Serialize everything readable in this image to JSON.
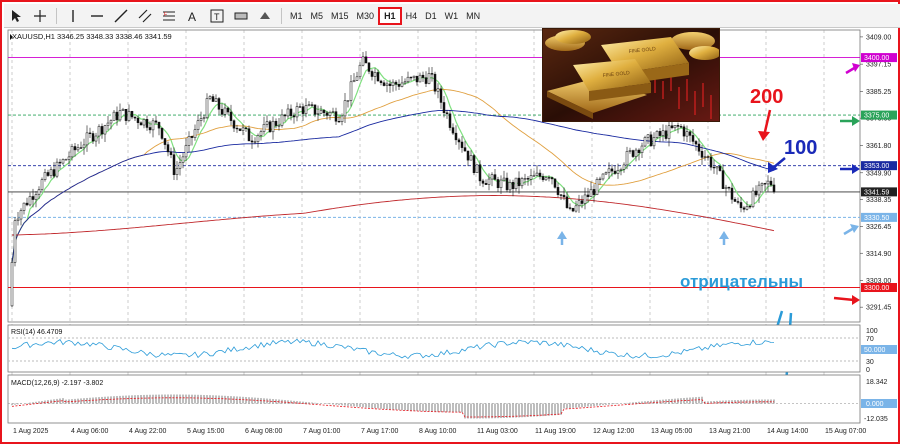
{
  "toolbar": {
    "timeframes": [
      "M1",
      "M5",
      "M15",
      "M30",
      "H1",
      "H4",
      "D1",
      "W1",
      "MN"
    ],
    "active_timeframe": "H1"
  },
  "header": {
    "symbol_info": "XAUUSD,H1  3346.25 3348.33 3338.46 3341.59"
  },
  "price_axis": {
    "ticks": [
      "3409.00",
      "3397.15",
      "3385.25",
      "3373.65",
      "3361.80",
      "3349.90",
      "3338.35",
      "3326.45",
      "3314.90",
      "3303.00",
      "3291.45"
    ],
    "levels": [
      {
        "label": "3400.00",
        "color": "#d000d0",
        "value": 3400.0
      },
      {
        "label": "3375.00",
        "color": "#2aa35a",
        "value": 3375.0
      },
      {
        "label": "3353.00",
        "color": "#1a2aa0",
        "value": 3353.0
      },
      {
        "label": "3341.59",
        "color": "#333333",
        "value": 3341.59
      },
      {
        "label": "3330.50",
        "color": "#7ab4e8",
        "value": 3330.5
      },
      {
        "label": "3300.00",
        "color": "#e8141c",
        "value": 3300.0
      }
    ],
    "range": [
      3285,
      3412
    ]
  },
  "time_axis": {
    "labels": [
      "1 Aug 2025",
      "4 Aug 06:00",
      "4 Aug 22:00",
      "5 Aug 15:00",
      "6 Aug 08:00",
      "7 Aug 01:00",
      "7 Aug 17:00",
      "8 Aug 10:00",
      "11 Aug 03:00",
      "11 Aug 19:00",
      "12 Aug 12:00",
      "13 Aug 05:00",
      "13 Aug 21:00",
      "14 Aug 14:00",
      "15 Aug 07:00"
    ]
  },
  "annotations": {
    "ma200": "200",
    "ma100": "100",
    "negative": "отрицательны"
  },
  "rsi": {
    "label": "RSI(14) 46.4709",
    "ticks": [
      "100",
      "70",
      "30",
      "0"
    ],
    "level_box": "50.000"
  },
  "macd": {
    "label": "MACD(12,26,9) -2.197 -3.802",
    "ticks": [
      "18.342",
      "0.000",
      "-12.035"
    ],
    "level_box": "0.000"
  },
  "colors": {
    "frame": "#e8141c",
    "ma_fast": "#7fe07f",
    "ma_orange": "#e0a040",
    "ma100": "#1a2aa0",
    "ma200": "#c0282c",
    "candle": "#111111",
    "rsi_line": "#2b9bd8"
  },
  "icons": [
    "cursor-icon",
    "crosshair-icon",
    "vertical-line-icon",
    "horizontal-line-icon",
    "trendline-icon",
    "equidistant-channel-icon",
    "fibonacci-icon",
    "text-icon",
    "text-label-icon",
    "rectangle-label-icon",
    "shapes-icon"
  ]
}
